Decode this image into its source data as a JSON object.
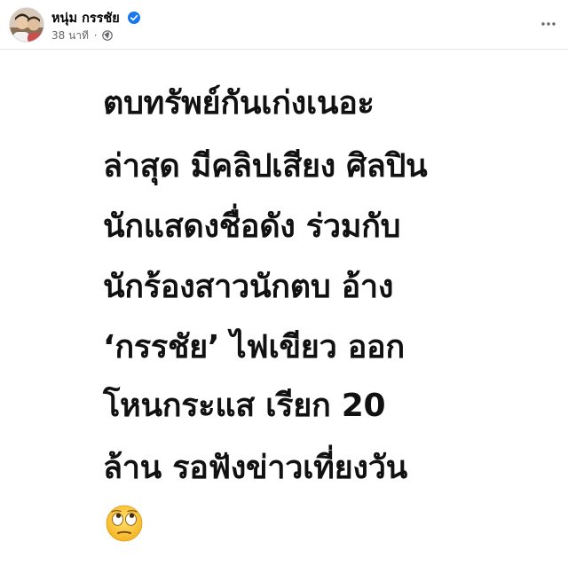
{
  "author": {
    "name": "หนุ่ม กรรชัย",
    "verified": true,
    "timestamp": "38 นาที",
    "separator": "·",
    "audience_icon": "globe-icon"
  },
  "menu": {
    "more_icon": "more-horizontal-icon"
  },
  "post": {
    "lines": [
      "ตบทรัพย์กันเก่งเนอะ",
      "ล่าสุด มีคลิปเสียง ศิลปิน",
      "นักแสดงชื่อดัง ร่วมกับ",
      "นักร้องสาวนักตบ อ้าง",
      "‘กรรชัย’ ไฟเขียว ออก",
      "โหนกระแส เรียก 20",
      "ล้าน รอฟังข่าวเที่ยงวัน"
    ],
    "emoji": "face-with-rolling-eyes"
  },
  "colors": {
    "text": "#111111",
    "meta": "#65676b",
    "verified": "#1877f2",
    "divider": "#e4e6eb"
  }
}
